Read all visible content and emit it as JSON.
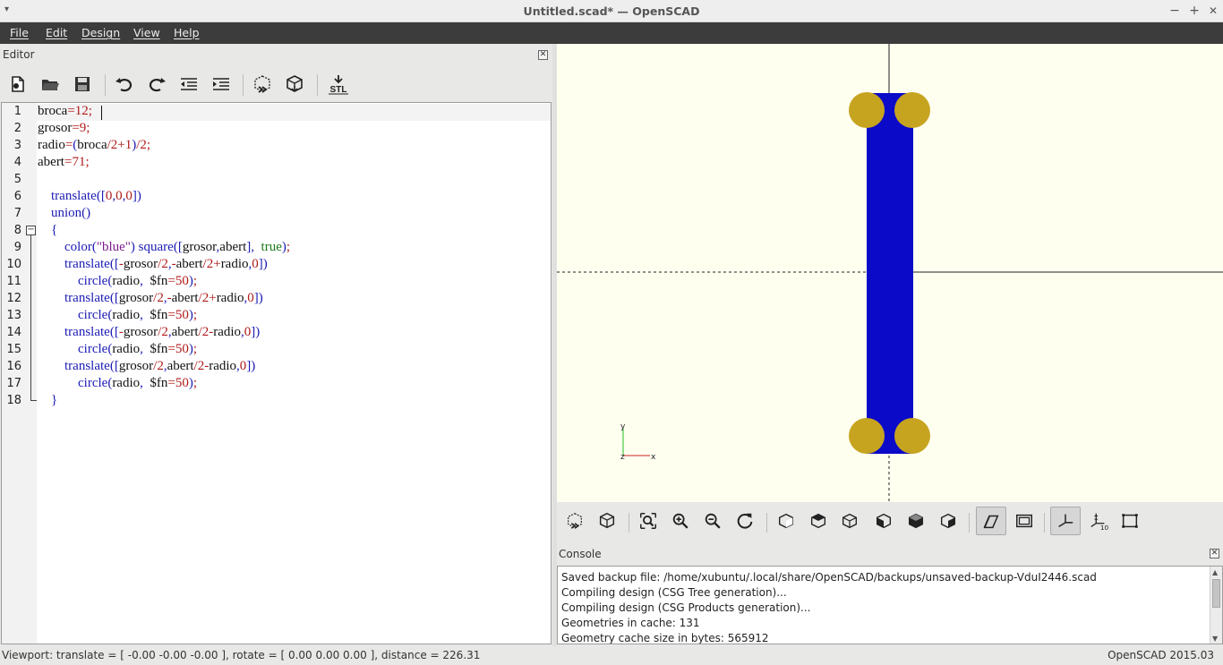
{
  "window": {
    "title": "Untitled.scad* — OpenSCAD",
    "menu_arrow": "▾",
    "minimize": "−",
    "maximize": "+",
    "close": "✕"
  },
  "menubar": {
    "items": [
      "File",
      "Edit",
      "Design",
      "View",
      "Help"
    ]
  },
  "editor": {
    "title": "Editor",
    "close": "✕",
    "toolbar": [
      "new-file-icon",
      "open-file-icon",
      "save-icon",
      "undo-icon",
      "redo-icon",
      "unindent-icon",
      "indent-icon",
      "preview-icon",
      "render-icon",
      "export-stl-icon"
    ],
    "stl_label": "STL",
    "line_numbers": [
      "1",
      "2",
      "3",
      "4",
      "5",
      "6",
      "7",
      "8",
      "9",
      "10",
      "11",
      "12",
      "13",
      "14",
      "15",
      "16",
      "17",
      "18"
    ],
    "code_lines": [
      "broca=12;",
      "grosor=9;",
      "radio=(broca/2+1)/2;",
      "abert=71;",
      "",
      "    translate([0,0,0])",
      "    union()",
      "    {",
      "        color(\"blue\") square([grosor,abert],  true);",
      "        translate([-grosor/2,-abert/2+radio,0])",
      "            circle(radio,  $fn=50);",
      "        translate([grosor/2,-abert/2+radio,0])",
      "            circle(radio,  $fn=50);",
      "        translate([-grosor/2,abert/2-radio,0])",
      "            circle(radio,  $fn=50);",
      "        translate([grosor/2,abert/2-radio,0])",
      "            circle(radio,  $fn=50);",
      "    }"
    ],
    "fold_marker": "−"
  },
  "viewport": {
    "background": "#fffff0",
    "body_color": "#0a0ac8",
    "circle_color": "#c7a420",
    "axis_labels": {
      "y": "y",
      "x": "x",
      "z": "z"
    }
  },
  "view_toolbar": [
    "preview-icon",
    "render-icon",
    "view-all-icon",
    "zoom-in-icon",
    "zoom-out-icon",
    "reset-view-icon",
    "view-right-icon",
    "view-top-icon",
    "view-bottom-icon",
    "view-left-icon",
    "view-front-icon",
    "view-back-icon",
    "perspective-icon",
    "orthogonal-icon",
    "show-axes-icon",
    "show-scale-markers-icon",
    "show-edges-icon"
  ],
  "console": {
    "title": "Console",
    "close": "✕",
    "lines": [
      "Saved backup file: /home/xubuntu/.local/share/OpenSCAD/backups/unsaved-backup-VduI2446.scad",
      "Compiling design (CSG Tree generation)...",
      "Compiling design (CSG Products generation)...",
      "Geometries in cache: 131",
      "Geometry cache size in bytes: 565912"
    ]
  },
  "statusbar": {
    "viewport_info": "Viewport: translate = [ -0.00 -0.00 -0.00 ], rotate = [ 0.00 0.00 0.00 ], distance = 226.31",
    "version": "OpenSCAD 2015.03"
  }
}
